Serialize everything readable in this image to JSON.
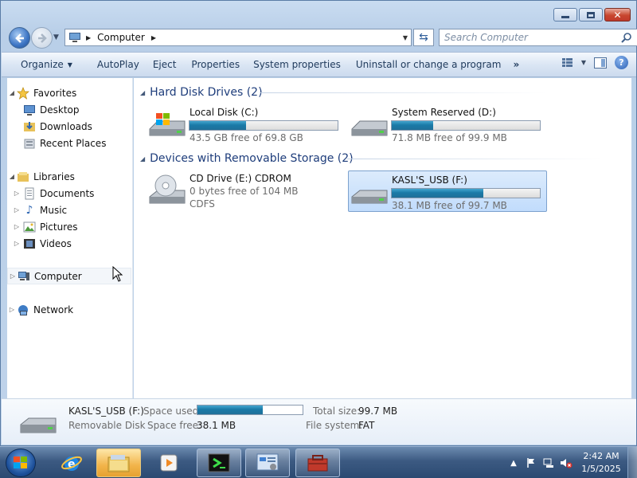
{
  "window": {
    "title": "Computer",
    "controls": {
      "minimize": "minimize-icon",
      "maximize": "maximize-icon",
      "close": "close-icon"
    }
  },
  "address_bar": {
    "breadcrumbs": [
      "Computer"
    ],
    "search_placeholder": "Search Computer"
  },
  "toolbar": {
    "organize": "Organize",
    "autoplay": "AutoPlay",
    "eject": "Eject",
    "properties": "Properties",
    "system_properties": "System properties",
    "uninstall": "Uninstall or change a program",
    "more": "»"
  },
  "nav_pane": {
    "favorites": {
      "label": "Favorites",
      "items": [
        "Desktop",
        "Downloads",
        "Recent Places"
      ]
    },
    "libraries": {
      "label": "Libraries",
      "items": [
        "Documents",
        "Music",
        "Pictures",
        "Videos"
      ]
    },
    "computer": "Computer",
    "network": "Network"
  },
  "groups": [
    {
      "title": "Hard Disk Drives (2)",
      "drives": [
        {
          "name": "Local Disk (C:)",
          "free_text": "43.5 GB free of 69.8 GB",
          "used_fraction": 0.38,
          "icon": "windows-drive-icon"
        },
        {
          "name": "System Reserved (D:)",
          "free_text": "71.8 MB free of 99.9 MB",
          "used_fraction": 0.28,
          "icon": "hard-drive-icon"
        }
      ]
    },
    {
      "title": "Devices with Removable Storage (2)",
      "drives": [
        {
          "name": "CD Drive (E:) CDROM",
          "line2": "0 bytes free of 104 MB",
          "line3": "CDFS",
          "icon": "cd-drive-icon"
        },
        {
          "name": "KASL'S_USB (F:)",
          "free_text": "38.1 MB free of 99.7 MB",
          "used_fraction": 0.62,
          "icon": "usb-drive-icon",
          "selected": true
        }
      ]
    }
  ],
  "details": {
    "name": "KASL'S_USB (F:)",
    "type": "Removable Disk",
    "space_used_label": "Space used:",
    "space_used_fraction": 0.62,
    "space_free_label": "Space free:",
    "space_free": "38.1 MB",
    "total_size_label": "Total size:",
    "total_size": "99.7 MB",
    "file_system_label": "File system:",
    "file_system": "FAT"
  },
  "taskbar": {
    "time": "2:42 AM",
    "date": "1/5/2025",
    "apps": [
      "internet-explorer-icon",
      "windows-explorer-icon",
      "media-player-icon",
      "terminal-icon",
      "control-panel-icon",
      "toolbox-icon"
    ]
  },
  "colors": {
    "accent_bar": "#1a7aa7",
    "group_header": "#1e3d7b",
    "selection": "#c1dcfc"
  }
}
